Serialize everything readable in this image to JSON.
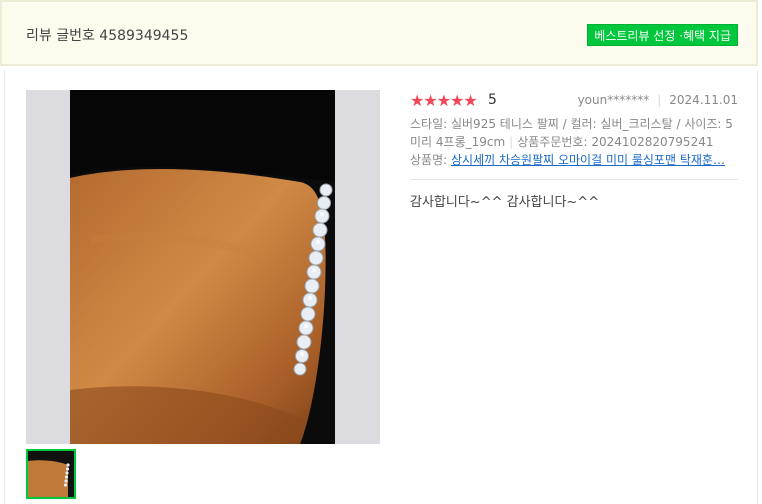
{
  "header": {
    "review_number": "리뷰 글번호 4589349455",
    "best_badge": "베스트리뷰 선정 ·혜택 지급"
  },
  "review": {
    "rating": 5,
    "rating_text": "5",
    "reviewer": "youn*******",
    "date": "2024.11.01",
    "options_line1": "스타일: 실버925 테니스 팔찌 / 컬러: 실버_크리스탈 / 사이즈: 5",
    "options_line2": "미리 4프롱_19cm",
    "order_no": "상품주문번호: 2024102820795241",
    "product_label": "상품명: ",
    "product_name": "상시세끼 차승원팔찌 오마이걸 미미 룰싱포맨 탁재훈…",
    "content": "감사합니다~^^ 감사합니다~^^"
  },
  "colors": {
    "star": "#f0475a",
    "badge": "#00c73c",
    "link": "#1b6ac9",
    "header_bg": "#fcfbee"
  },
  "icons": {
    "star": "star-icon"
  },
  "media": {
    "photo": "photo of wrist wearing silver tennis bracelet",
    "thumbnail": "thumbnail of wrist wearing silver tennis bracelet"
  }
}
